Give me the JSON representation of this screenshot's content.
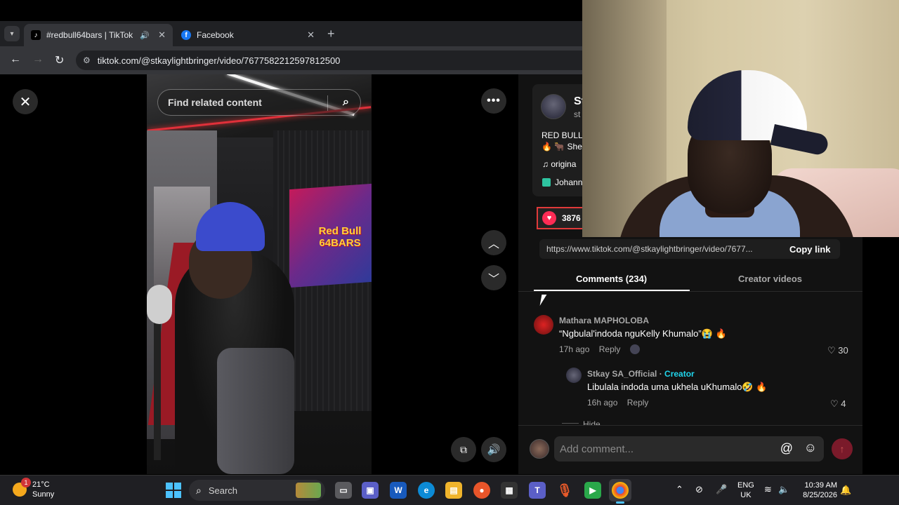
{
  "browser": {
    "tabs": [
      {
        "title": "#redbull64bars | TikTok",
        "favicon": "tiktok-icon",
        "active": true
      },
      {
        "title": "Facebook",
        "favicon": "facebook-icon",
        "active": false
      }
    ],
    "url": "tiktok.com/@stkaylightbringer/video/7677582212597812500"
  },
  "video": {
    "search_placeholder": "Find related content",
    "overlay_logo_line1": "Red Bull",
    "overlay_logo_line2": "64BARS"
  },
  "info": {
    "name_partial": "St",
    "handle_partial": "st",
    "desc_line1": "RED BULL",
    "desc_line2": "🔥 🐂 She",
    "music_partial": "origina",
    "tag_partial": "Johann",
    "likes_partial": "3876"
  },
  "share": {
    "link": "https://www.tiktok.com/@stkaylightbringer/video/7677...",
    "copy_label": "Copy link"
  },
  "tabs": {
    "comments": "Comments (234)",
    "creator_videos": "Creator videos"
  },
  "comments": [
    {
      "user": "Mathara MAPHOLOBA",
      "text": "“Ngbulal'indoda nguKelly Khumalo”😭 🔥",
      "time": "17h ago",
      "reply": "Reply",
      "likes": "30"
    },
    {
      "user": "Stkay SA_Official",
      "badge": "Creator",
      "separator": " · ",
      "text": "Libulala indoda uma ukhela uKhumalo🤣 🔥",
      "time": "16h ago",
      "reply": "Reply",
      "likes": "4"
    }
  ],
  "hide_label": "Hide",
  "composer": {
    "placeholder": "Add comment..."
  },
  "taskbar": {
    "temp": "21°C",
    "condition": "Sunny",
    "weather_badge": "1",
    "search_label": "Search",
    "lang_line1": "ENG",
    "lang_line2": "UK",
    "time": "10:39 AM",
    "date": "8/25/2026"
  },
  "colors": {
    "tiktok_red": "#fe2c55",
    "creator_cyan": "#20d5ec",
    "windows_accent": "#4cc2ff"
  }
}
